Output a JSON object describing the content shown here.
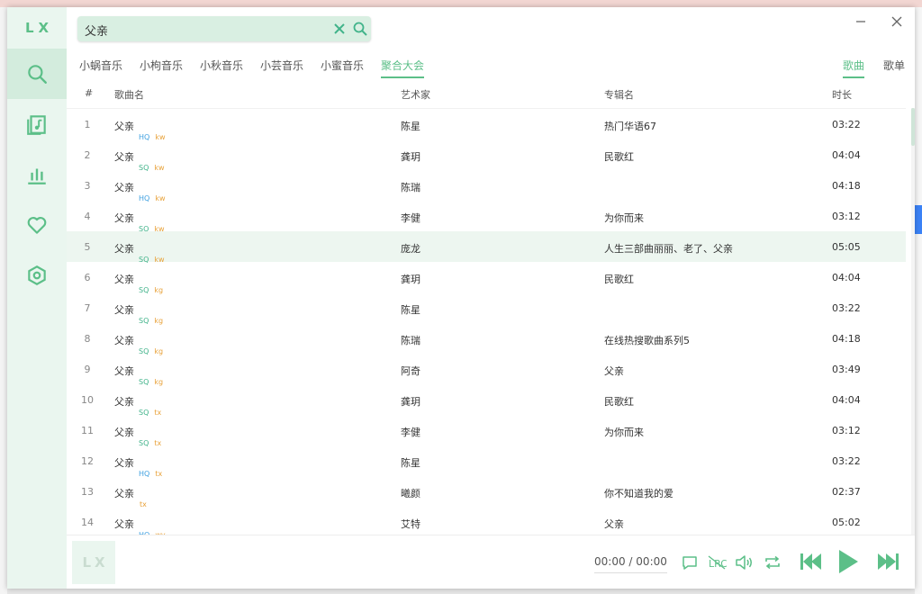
{
  "app": {
    "logo": "LX"
  },
  "search": {
    "value": "父亲",
    "placeholder": ""
  },
  "sources": [
    {
      "label": "小蜗音乐"
    },
    {
      "label": "小枸音乐"
    },
    {
      "label": "小秋音乐"
    },
    {
      "label": "小芸音乐"
    },
    {
      "label": "小蜜音乐"
    },
    {
      "label": "聚合大会"
    }
  ],
  "search_types": [
    {
      "label": "歌曲"
    },
    {
      "label": "歌单"
    }
  ],
  "table": {
    "headers": {
      "index": "#",
      "name": "歌曲名",
      "artist": "艺术家",
      "album": "专辑名",
      "duration": "时长"
    },
    "rows": [
      {
        "num": "1",
        "name": "父亲",
        "quality": "HQ",
        "source": "kw",
        "artist": "陈星",
        "album": "热门华语67",
        "duration": "03:22"
      },
      {
        "num": "2",
        "name": "父亲",
        "quality": "SQ",
        "source": "kw",
        "artist": "龚玥",
        "album": "民歌红",
        "duration": "04:04"
      },
      {
        "num": "3",
        "name": "父亲",
        "quality": "HQ",
        "source": "kw",
        "artist": "陈瑞",
        "album": "",
        "duration": "04:18"
      },
      {
        "num": "4",
        "name": "父亲",
        "quality": "SQ",
        "source": "kw",
        "artist": "李健",
        "album": "为你而来",
        "duration": "03:12"
      },
      {
        "num": "5",
        "name": "父亲",
        "quality": "SQ",
        "source": "kw",
        "artist": "庞龙",
        "album": "人生三部曲丽丽、老了、父亲",
        "duration": "05:05"
      },
      {
        "num": "6",
        "name": "父亲",
        "quality": "SQ",
        "source": "kg",
        "artist": "龚玥",
        "album": "民歌红",
        "duration": "04:04"
      },
      {
        "num": "7",
        "name": "父亲",
        "quality": "SQ",
        "source": "kg",
        "artist": "陈星",
        "album": "",
        "duration": "03:22"
      },
      {
        "num": "8",
        "name": "父亲",
        "quality": "SQ",
        "source": "kg",
        "artist": "陈瑞",
        "album": "在线热搜歌曲系列5",
        "duration": "04:18"
      },
      {
        "num": "9",
        "name": "父亲",
        "quality": "SQ",
        "source": "kg",
        "artist": "阿奇",
        "album": "父亲",
        "duration": "03:49"
      },
      {
        "num": "10",
        "name": "父亲",
        "quality": "SQ",
        "source": "tx",
        "artist": "龚玥",
        "album": "民歌红",
        "duration": "04:04"
      },
      {
        "num": "11",
        "name": "父亲",
        "quality": "SQ",
        "source": "tx",
        "artist": "李健",
        "album": "为你而来",
        "duration": "03:12"
      },
      {
        "num": "12",
        "name": "父亲",
        "quality": "HQ",
        "source": "tx",
        "artist": "陈星",
        "album": "",
        "duration": "03:22"
      },
      {
        "num": "13",
        "name": "父亲",
        "quality": "",
        "source": "tx",
        "artist": "曦颜",
        "album": "你不知道我的爱",
        "duration": "02:37"
      },
      {
        "num": "14",
        "name": "父亲",
        "quality": "HQ",
        "source": "wy",
        "artist": "艾特",
        "album": "父亲",
        "duration": "05:02"
      }
    ]
  },
  "player": {
    "cover_text": "LX",
    "current_time": "00:00",
    "separator": "/",
    "total_time": "00:00"
  },
  "colors": {
    "accent": "#5cbf88",
    "sidebar_bg": "#eaf6ef",
    "hq": "#3fa0e0",
    "sq": "#41b38a",
    "source_tag": "#e8a23a"
  }
}
